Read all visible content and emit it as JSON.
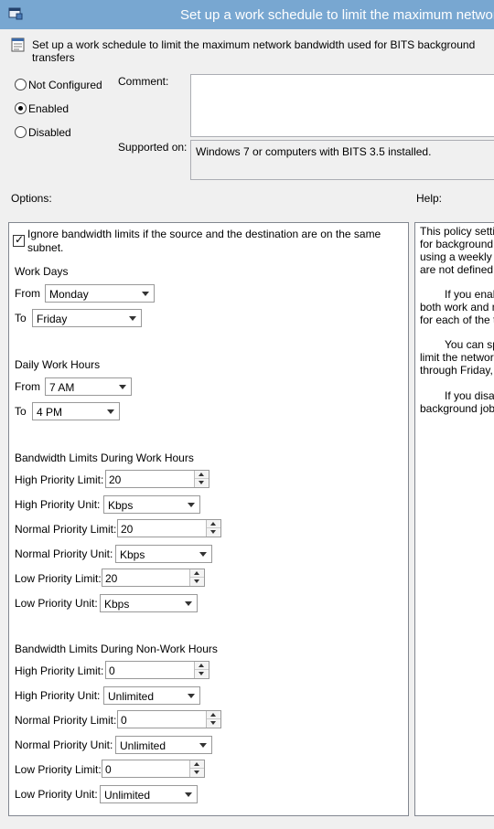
{
  "window": {
    "title": "Set up a work schedule to limit the maximum network b"
  },
  "header": {
    "text": "Set up a work schedule to limit the maximum network bandwidth used for BITS background transfers"
  },
  "state": {
    "options": [
      "Not Configured",
      "Enabled",
      "Disabled"
    ],
    "selected": "Enabled"
  },
  "comment": {
    "label": "Comment:",
    "value": ""
  },
  "supported": {
    "label": "Supported on:",
    "value": "Windows 7 or computers with BITS 3.5 installed."
  },
  "options_label": "Options:",
  "help_label": "Help:",
  "opts": {
    "ignore_line1": "Ignore bandwidth limits if the source and the destination are on the same",
    "ignore_line2": "subnet.",
    "ignore_checked": true,
    "work_days": {
      "heading": "Work Days",
      "from_label": "From",
      "from_value": "Monday",
      "to_label": "To",
      "to_value": "Friday"
    },
    "work_hours": {
      "heading": "Daily Work Hours",
      "from_label": "From",
      "from_value": "7 AM",
      "to_label": "To",
      "to_value": "4 PM"
    },
    "work_limits": {
      "heading": "Bandwidth Limits During Work Hours",
      "high_limit_label": "High Priority Limit:",
      "high_limit": "20",
      "high_unit_label": "High Priority Unit:",
      "high_unit": "Kbps",
      "normal_limit_label": "Normal Priority Limit:",
      "normal_limit": "20",
      "normal_unit_label": "Normal Priority Unit:",
      "normal_unit": "Kbps",
      "low_limit_label": "Low Priority Limit:",
      "low_limit": "20",
      "low_unit_label": "Low Priority Unit:",
      "low_unit": "Kbps"
    },
    "nonwork_limits": {
      "heading": "Bandwidth Limits During Non-Work Hours",
      "high_limit_label": "High Priority Limit:",
      "high_limit": "0",
      "high_unit_label": "High Priority Unit:",
      "high_unit": "Unlimited",
      "normal_limit_label": "Normal Priority Limit:",
      "normal_limit": "0",
      "normal_unit_label": "Normal Priority Unit:",
      "normal_unit": "Unlimited",
      "low_limit_label": "Low Priority Limit:",
      "low_limit": "0",
      "low_unit_label": "Low Priority Unit:",
      "low_unit": "Unlimited"
    }
  },
  "help": {
    "p1": [
      "This policy settin",
      "for background t",
      "using a weekly ca",
      "are not defined in"
    ],
    "p2": [
      "If you enab",
      "both work and n",
      "for each of the th"
    ],
    "p3": [
      "You can sp",
      "limit the network",
      "through Friday, a"
    ],
    "p4": [
      "If you disab",
      "background job t"
    ]
  },
  "icons": {
    "app": "policy-editor-icon",
    "header": "policy-setting-icon"
  }
}
